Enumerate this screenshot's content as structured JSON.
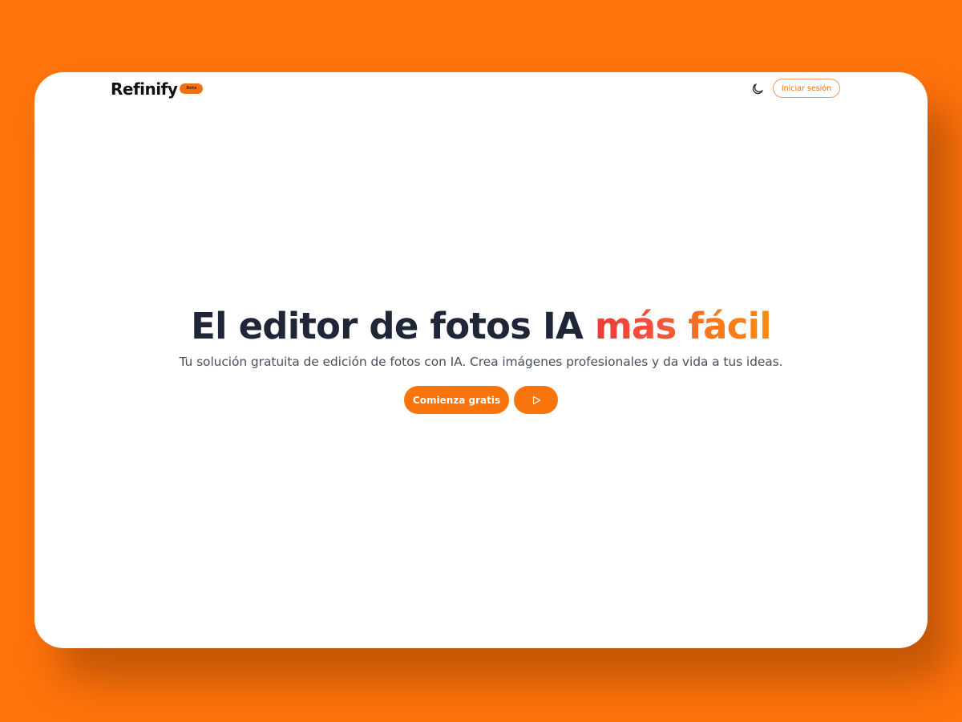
{
  "header": {
    "brand_name": "Refinify",
    "badge": "Beta",
    "theme_toggle_icon": "moon-icon",
    "login_label": "Iniciar sesión"
  },
  "hero": {
    "title_main": "El editor de fotos IA ",
    "title_highlight": "más fácil",
    "subtitle": "Tu solución gratuita de edición de fotos con IA. Crea imágenes profesionales y da vida a tus ideas.",
    "cta_label": "Comienza gratis",
    "play_icon": "play-icon"
  },
  "colors": {
    "background": "#ff730b",
    "accent": "#f9740b",
    "title_text": "#1e2638",
    "highlight_gradient_start": "#ee3b3b",
    "highlight_gradient_end": "#fb8b10"
  }
}
